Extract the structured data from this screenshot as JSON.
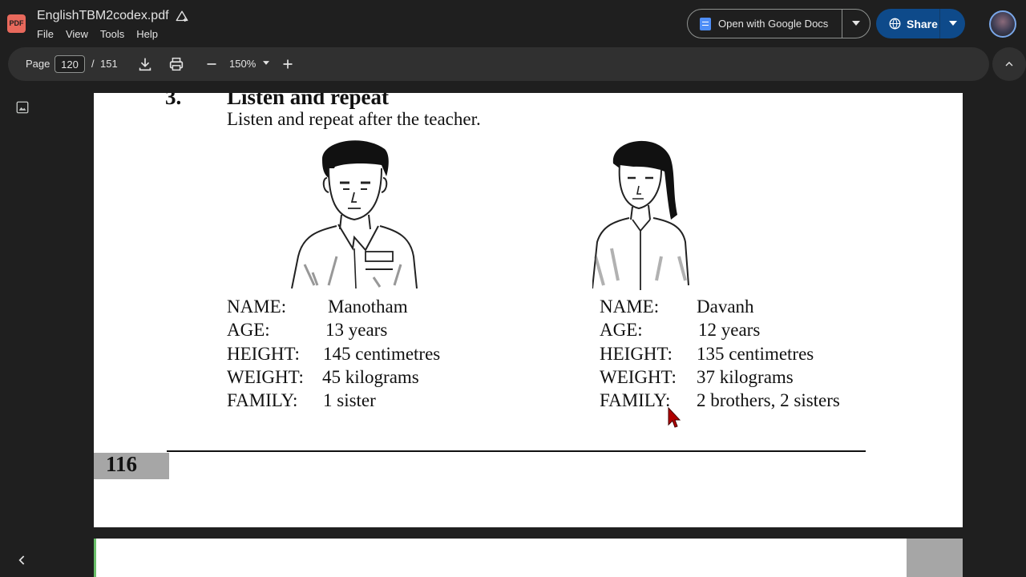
{
  "app": {
    "file_badge": "PDF",
    "file_name": "EnglishTBM2codex.pdf",
    "menu": [
      "File",
      "View",
      "Tools",
      "Help"
    ],
    "open_with_label": "Open with Google Docs",
    "share_label": "Share"
  },
  "toolbar": {
    "page_label": "Page",
    "current_page": "120",
    "page_separator": "/",
    "total_pages": "151",
    "zoom": "150%"
  },
  "document": {
    "section_number": "3.",
    "section_title": "Listen and repeat",
    "instruction": "Listen and repeat after the teacher.",
    "profiles": [
      {
        "rows": [
          {
            "label": "NAME:",
            "value": "Manotham"
          },
          {
            "label": "AGE:",
            "value": "13 years"
          },
          {
            "label": "HEIGHT:",
            "value": "145 centimetres"
          },
          {
            "label": "WEIGHT:",
            "value": "45 kilograms"
          },
          {
            "label": "FAMILY:",
            "value": "1 sister"
          }
        ]
      },
      {
        "rows": [
          {
            "label": "NAME:",
            "value": "Davanh"
          },
          {
            "label": "AGE:",
            "value": "12 years"
          },
          {
            "label": "HEIGHT:",
            "value": "135 centimetres"
          },
          {
            "label": "WEIGHT:",
            "value": "37 kilograms"
          },
          {
            "label": "FAMILY:",
            "value": "2 brothers, 2 sisters"
          }
        ]
      }
    ],
    "page_number": "116"
  },
  "icons": {
    "drive": "add-to-drive-icon",
    "docs": "google-docs-icon",
    "share": "globe-icon",
    "download": "download-icon",
    "print": "print-icon",
    "zoom_out": "minus-icon",
    "zoom_in": "plus-icon",
    "collapse": "chevron-up-icon",
    "thumbnails": "image-icon",
    "back": "chevron-left-icon"
  },
  "colors": {
    "background": "#1f1f1f",
    "toolbar": "#303030",
    "share_button": "#0e4a8a",
    "pdf_badge": "#e8695c",
    "page_number_box": "#a6a6a6"
  }
}
